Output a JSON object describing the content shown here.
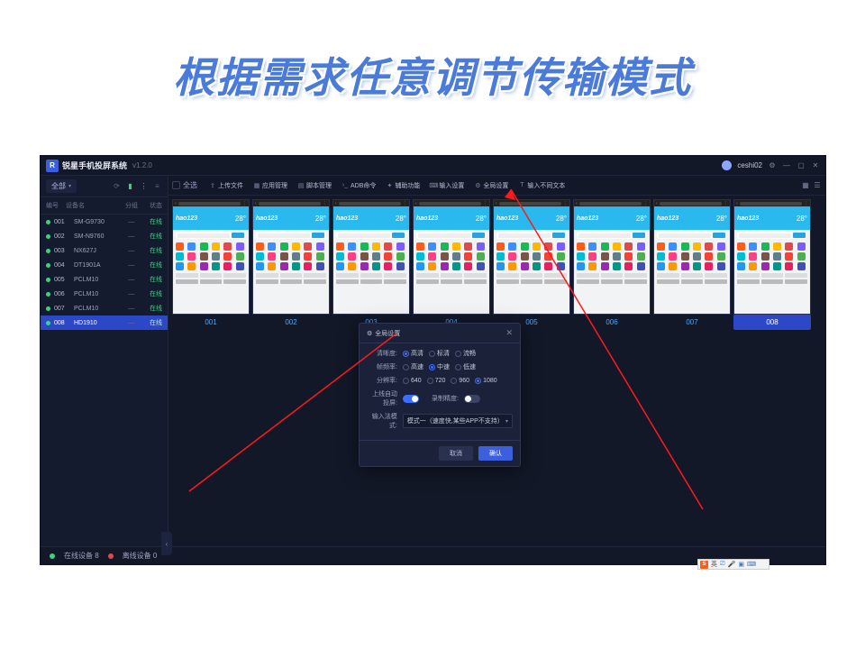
{
  "page_title": "根据需求任意调节传输模式",
  "header": {
    "app_name": "锐星手机投屏系统",
    "version": "v1.2.0",
    "user": "ceshi02"
  },
  "sidebar": {
    "filter_label": "全部",
    "columns": {
      "id": "编号",
      "name": "设备名",
      "group": "分组",
      "status": "状态"
    },
    "devices": [
      {
        "id": "001",
        "name": "SM-G9730",
        "group": "—",
        "status": "在线",
        "selected": false
      },
      {
        "id": "002",
        "name": "SM-N9760",
        "group": "—",
        "status": "在线",
        "selected": false
      },
      {
        "id": "003",
        "name": "NX627J",
        "group": "—",
        "status": "在线",
        "selected": false
      },
      {
        "id": "004",
        "name": "DT1901A",
        "group": "—",
        "status": "在线",
        "selected": false
      },
      {
        "id": "005",
        "name": "PCLM10",
        "group": "—",
        "status": "在线",
        "selected": false
      },
      {
        "id": "006",
        "name": "PCLM10",
        "group": "—",
        "status": "在线",
        "selected": false
      },
      {
        "id": "007",
        "name": "PCLM10",
        "group": "—",
        "status": "在线",
        "selected": false
      },
      {
        "id": "008",
        "name": "HD1910",
        "group": "—",
        "status": "在线",
        "selected": true
      }
    ]
  },
  "toolbar": {
    "select_all": "全选",
    "items": [
      "上传文件",
      "应用管理",
      "脚本管理",
      "ADB命令",
      "辅助功能",
      "输入设置",
      "全局设置",
      "输入不同文本"
    ]
  },
  "phones": {
    "brand": "hao123",
    "temp": "28°",
    "search_btn": "搜索一下",
    "labels": [
      "001",
      "002",
      "003",
      "004",
      "005",
      "006",
      "007",
      "008"
    ],
    "selected_index": 7
  },
  "modal": {
    "title": "全局设置",
    "rows": {
      "clarity": {
        "label": "清晰度:",
        "opts": [
          "高清",
          "标清",
          "流畅"
        ],
        "sel": 0
      },
      "fps": {
        "label": "帧频率:",
        "opts": [
          "高速",
          "中速",
          "低速"
        ],
        "sel": 1
      },
      "res": {
        "label": "分辨率:",
        "opts": [
          "640",
          "720",
          "960",
          "1080"
        ],
        "sel": 3
      },
      "auto": {
        "label": "上线自动投屏:",
        "alt_label": "录制精度:",
        "on": true,
        "alt_on": false
      },
      "ime": {
        "label": "输入法模式:",
        "value": "模式一（速度快,某些APP不支持）"
      }
    },
    "cancel": "取消",
    "ok": "确认"
  },
  "footer": {
    "online_label": "在线设备",
    "online_count": "8",
    "offline_label": "离线设备",
    "offline_count": "0"
  },
  "ime_bar": "英"
}
